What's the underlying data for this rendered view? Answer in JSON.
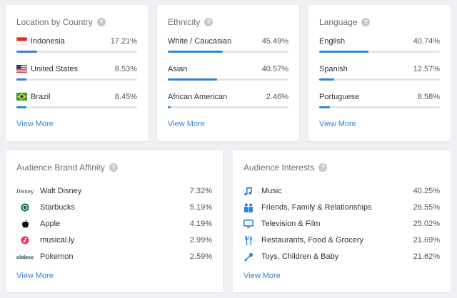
{
  "colors": {
    "accent": "#2f84d6",
    "track": "#e3e5e8"
  },
  "country": {
    "title": "Location by Country",
    "help": "?",
    "items": [
      {
        "name": "Indonesia",
        "percent": "17.21%",
        "fill": 0.1721,
        "flag": "indonesia-flag-icon"
      },
      {
        "name": "United States",
        "percent": "8.53%",
        "fill": 0.0853,
        "flag": "us-flag-icon"
      },
      {
        "name": "Brazil",
        "percent": "8.45%",
        "fill": 0.0845,
        "flag": "brazil-flag-icon"
      }
    ],
    "view_more": "View More"
  },
  "ethnicity": {
    "title": "Ethnicity",
    "help": "?",
    "items": [
      {
        "name": "White / Caucasian",
        "percent": "45.49%",
        "fill": 0.4549
      },
      {
        "name": "Asian",
        "percent": "40.57%",
        "fill": 0.4057
      },
      {
        "name": "African American",
        "percent": "2.46%",
        "fill": 0.0246
      }
    ],
    "view_more": "View More"
  },
  "language": {
    "title": "Language",
    "help": "?",
    "items": [
      {
        "name": "English",
        "percent": "40.74%",
        "fill": 0.4074
      },
      {
        "name": "Spanish",
        "percent": "12.57%",
        "fill": 0.1257
      },
      {
        "name": "Portuguese",
        "percent": "8.58%",
        "fill": 0.0858
      }
    ],
    "view_more": "View More"
  },
  "brand": {
    "title": "Audience Brand Affinity",
    "help": "?",
    "items": [
      {
        "name": "Walt Disney",
        "percent": "7.32%",
        "icon": "disney-logo-icon",
        "logo_text": "Disney"
      },
      {
        "name": "Starbucks",
        "percent": "5.19%",
        "icon": "starbucks-logo-icon"
      },
      {
        "name": "Apple",
        "percent": "4.19%",
        "icon": "apple-logo-icon"
      },
      {
        "name": "musical.ly",
        "percent": "2.99%",
        "icon": "musically-logo-icon"
      },
      {
        "name": "Pokemon",
        "percent": "2.59%",
        "icon": "pokemon-logo-icon",
        "logo_text": "Pokémon"
      }
    ],
    "view_more": "View More"
  },
  "interests": {
    "title": "Audience Interests",
    "help": "?",
    "items": [
      {
        "name": "Music",
        "percent": "40.25%",
        "icon": "music-note-icon"
      },
      {
        "name": "Friends, Family & Relationships",
        "percent": "26.55%",
        "icon": "people-icon"
      },
      {
        "name": "Television & Film",
        "percent": "25.02%",
        "icon": "tv-icon"
      },
      {
        "name": "Restaurants, Food & Grocery",
        "percent": "21.69%",
        "icon": "fork-knife-icon"
      },
      {
        "name": "Toys, Children & Baby",
        "percent": "21.62%",
        "icon": "toy-icon"
      }
    ],
    "view_more": "View More"
  }
}
